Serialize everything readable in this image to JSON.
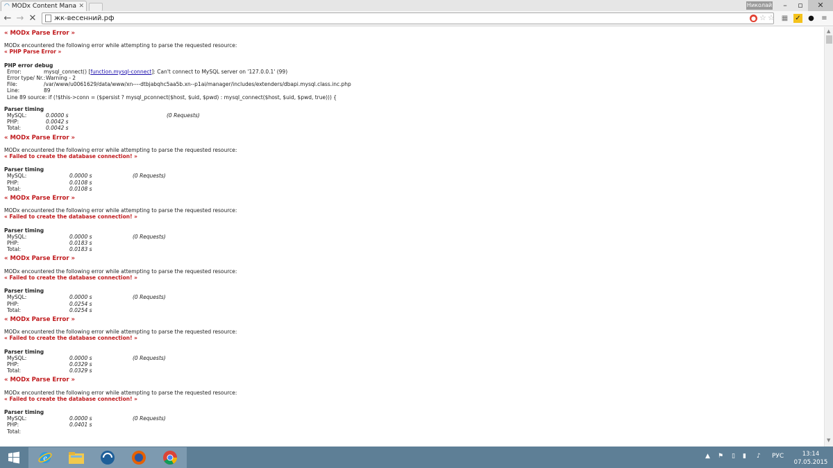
{
  "browser": {
    "tab_title": "MODx Content Mana",
    "user_name": "Николай",
    "url": "жк-весенний.рф"
  },
  "page": {
    "error_title": "« MODx Parse Error »",
    "intro": "MODx encountered the following error while attempting to parse the requested resource:",
    "php_error": "« PHP Parse Error »",
    "debug_heading": "PHP error debug",
    "debug": {
      "error_label": "Error:",
      "error_pre": "mysql_connect() [",
      "error_link": "function.mysql-connect",
      "error_post": "]: Can't connect to MySQL server on '127.0.0.1' (99)",
      "type_label": "Error type/ Nr.:",
      "type_value": "Warning - 2",
      "file_label": "File:",
      "file_value": "/var/www/u0061629/data/www/xn----dtbjabqhc5aa5b.xn--p1ai/manager/includes/extenders/dbapi.mysql.class.inc.php",
      "line_label": "Line:",
      "line_value": "89",
      "source_line": "Line 89 source: if (!$this->conn = ($persist ? mysql_pconnect($host, $uid, $pwd) : mysql_connect($host, $uid, $pwd, true))) {"
    },
    "timing_heading": "Parser timing",
    "mysql_label": "MySQL:",
    "php_label": "PHP:",
    "total_label": "Total:",
    "first_timing": {
      "mysql": "0.0000 s",
      "requests": "(0 Requests)",
      "php": "0.0042 s",
      "total": "0.0042 s"
    },
    "db_error": "« Failed to create the database connection! »",
    "blocks": [
      {
        "mysql": "0.0000 s",
        "requests": "(0 Requests)",
        "php": "0.0108 s",
        "total": "0.0108 s"
      },
      {
        "mysql": "0.0000 s",
        "requests": "(0 Requests)",
        "php": "0.0183 s",
        "total": "0.0183 s"
      },
      {
        "mysql": "0.0000 s",
        "requests": "(0 Requests)",
        "php": "0.0254 s",
        "total": "0.0254 s"
      },
      {
        "mysql": "0.0000 s",
        "requests": "(0 Requests)",
        "php": "0.0329 s",
        "total": "0.0329 s"
      },
      {
        "mysql": "0.0000 s",
        "requests": "(0 Requests)",
        "php": "0.0401 s",
        "total": ""
      }
    ]
  },
  "taskbar": {
    "language": "РУС",
    "time": "13:14",
    "date": "07.05.2015"
  }
}
